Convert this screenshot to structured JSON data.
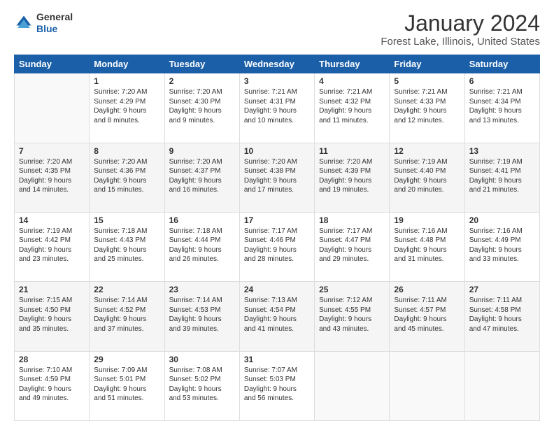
{
  "header": {
    "logo_line1": "General",
    "logo_line2": "Blue",
    "title": "January 2024",
    "subtitle": "Forest Lake, Illinois, United States"
  },
  "calendar": {
    "days_of_week": [
      "Sunday",
      "Monday",
      "Tuesday",
      "Wednesday",
      "Thursday",
      "Friday",
      "Saturday"
    ],
    "weeks": [
      [
        {
          "day": "",
          "info": ""
        },
        {
          "day": "1",
          "info": "Sunrise: 7:20 AM\nSunset: 4:29 PM\nDaylight: 9 hours\nand 8 minutes."
        },
        {
          "day": "2",
          "info": "Sunrise: 7:20 AM\nSunset: 4:30 PM\nDaylight: 9 hours\nand 9 minutes."
        },
        {
          "day": "3",
          "info": "Sunrise: 7:21 AM\nSunset: 4:31 PM\nDaylight: 9 hours\nand 10 minutes."
        },
        {
          "day": "4",
          "info": "Sunrise: 7:21 AM\nSunset: 4:32 PM\nDaylight: 9 hours\nand 11 minutes."
        },
        {
          "day": "5",
          "info": "Sunrise: 7:21 AM\nSunset: 4:33 PM\nDaylight: 9 hours\nand 12 minutes."
        },
        {
          "day": "6",
          "info": "Sunrise: 7:21 AM\nSunset: 4:34 PM\nDaylight: 9 hours\nand 13 minutes."
        }
      ],
      [
        {
          "day": "7",
          "info": "Sunrise: 7:20 AM\nSunset: 4:35 PM\nDaylight: 9 hours\nand 14 minutes."
        },
        {
          "day": "8",
          "info": "Sunrise: 7:20 AM\nSunset: 4:36 PM\nDaylight: 9 hours\nand 15 minutes."
        },
        {
          "day": "9",
          "info": "Sunrise: 7:20 AM\nSunset: 4:37 PM\nDaylight: 9 hours\nand 16 minutes."
        },
        {
          "day": "10",
          "info": "Sunrise: 7:20 AM\nSunset: 4:38 PM\nDaylight: 9 hours\nand 17 minutes."
        },
        {
          "day": "11",
          "info": "Sunrise: 7:20 AM\nSunset: 4:39 PM\nDaylight: 9 hours\nand 19 minutes."
        },
        {
          "day": "12",
          "info": "Sunrise: 7:19 AM\nSunset: 4:40 PM\nDaylight: 9 hours\nand 20 minutes."
        },
        {
          "day": "13",
          "info": "Sunrise: 7:19 AM\nSunset: 4:41 PM\nDaylight: 9 hours\nand 21 minutes."
        }
      ],
      [
        {
          "day": "14",
          "info": "Sunrise: 7:19 AM\nSunset: 4:42 PM\nDaylight: 9 hours\nand 23 minutes."
        },
        {
          "day": "15",
          "info": "Sunrise: 7:18 AM\nSunset: 4:43 PM\nDaylight: 9 hours\nand 25 minutes."
        },
        {
          "day": "16",
          "info": "Sunrise: 7:18 AM\nSunset: 4:44 PM\nDaylight: 9 hours\nand 26 minutes."
        },
        {
          "day": "17",
          "info": "Sunrise: 7:17 AM\nSunset: 4:46 PM\nDaylight: 9 hours\nand 28 minutes."
        },
        {
          "day": "18",
          "info": "Sunrise: 7:17 AM\nSunset: 4:47 PM\nDaylight: 9 hours\nand 29 minutes."
        },
        {
          "day": "19",
          "info": "Sunrise: 7:16 AM\nSunset: 4:48 PM\nDaylight: 9 hours\nand 31 minutes."
        },
        {
          "day": "20",
          "info": "Sunrise: 7:16 AM\nSunset: 4:49 PM\nDaylight: 9 hours\nand 33 minutes."
        }
      ],
      [
        {
          "day": "21",
          "info": "Sunrise: 7:15 AM\nSunset: 4:50 PM\nDaylight: 9 hours\nand 35 minutes."
        },
        {
          "day": "22",
          "info": "Sunrise: 7:14 AM\nSunset: 4:52 PM\nDaylight: 9 hours\nand 37 minutes."
        },
        {
          "day": "23",
          "info": "Sunrise: 7:14 AM\nSunset: 4:53 PM\nDaylight: 9 hours\nand 39 minutes."
        },
        {
          "day": "24",
          "info": "Sunrise: 7:13 AM\nSunset: 4:54 PM\nDaylight: 9 hours\nand 41 minutes."
        },
        {
          "day": "25",
          "info": "Sunrise: 7:12 AM\nSunset: 4:55 PM\nDaylight: 9 hours\nand 43 minutes."
        },
        {
          "day": "26",
          "info": "Sunrise: 7:11 AM\nSunset: 4:57 PM\nDaylight: 9 hours\nand 45 minutes."
        },
        {
          "day": "27",
          "info": "Sunrise: 7:11 AM\nSunset: 4:58 PM\nDaylight: 9 hours\nand 47 minutes."
        }
      ],
      [
        {
          "day": "28",
          "info": "Sunrise: 7:10 AM\nSunset: 4:59 PM\nDaylight: 9 hours\nand 49 minutes."
        },
        {
          "day": "29",
          "info": "Sunrise: 7:09 AM\nSunset: 5:01 PM\nDaylight: 9 hours\nand 51 minutes."
        },
        {
          "day": "30",
          "info": "Sunrise: 7:08 AM\nSunset: 5:02 PM\nDaylight: 9 hours\nand 53 minutes."
        },
        {
          "day": "31",
          "info": "Sunrise: 7:07 AM\nSunset: 5:03 PM\nDaylight: 9 hours\nand 56 minutes."
        },
        {
          "day": "",
          "info": ""
        },
        {
          "day": "",
          "info": ""
        },
        {
          "day": "",
          "info": ""
        }
      ]
    ]
  }
}
